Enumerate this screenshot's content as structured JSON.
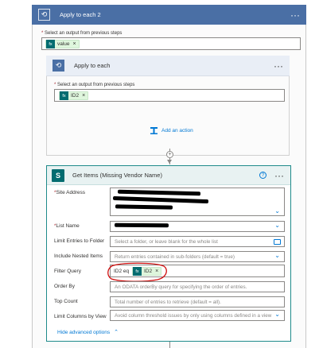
{
  "outer_loop": {
    "title": "Apply to each 2",
    "menu": "···",
    "field_label": "Select an output from previous steps",
    "token": {
      "icon_text": "fx",
      "label": "value",
      "remove": "×"
    }
  },
  "inner_loop": {
    "title": "Apply to each",
    "menu": "···",
    "field_label": "Select an output from previous steps",
    "token": {
      "icon_text": "fx",
      "label": "ID2",
      "remove": "×"
    },
    "add_action": "Add an action"
  },
  "insert_step": "+",
  "get_items": {
    "icon_text": "S",
    "title": "Get Items (Missing Vendor Name)",
    "help": "?",
    "menu": "···",
    "fields": {
      "site_address": {
        "label": "Site Address"
      },
      "list_name": {
        "label": "List Name"
      },
      "limit_folder": {
        "label": "Limit Entries to Folder",
        "placeholder": "Select a folder, or leave blank for the whole list"
      },
      "nested": {
        "label": "Include Nested Items",
        "placeholder": "Return entries contained in sub-folders (default = true)"
      },
      "filter_query": {
        "label": "Filter Query",
        "text": "ID2 eq",
        "token": {
          "icon_text": "fx",
          "label": "ID2",
          "remove": "×"
        }
      },
      "order_by": {
        "label": "Order By",
        "placeholder": "An ODATA orderBy query for specifying the order of entries."
      },
      "top_count": {
        "label": "Top Count",
        "placeholder": "Total number of entries to retrieve (default = all)."
      },
      "limit_view": {
        "label": "Limit Columns by View",
        "placeholder": "Avoid column threshold issues by only using columns defined in a view"
      }
    },
    "advanced": "Hide advanced options",
    "required_mark": "*"
  },
  "colors": {
    "loop_header": "#4a6fa5",
    "sharepoint": "#036c70",
    "accent": "#0078d4",
    "annotation": "#d01010"
  }
}
